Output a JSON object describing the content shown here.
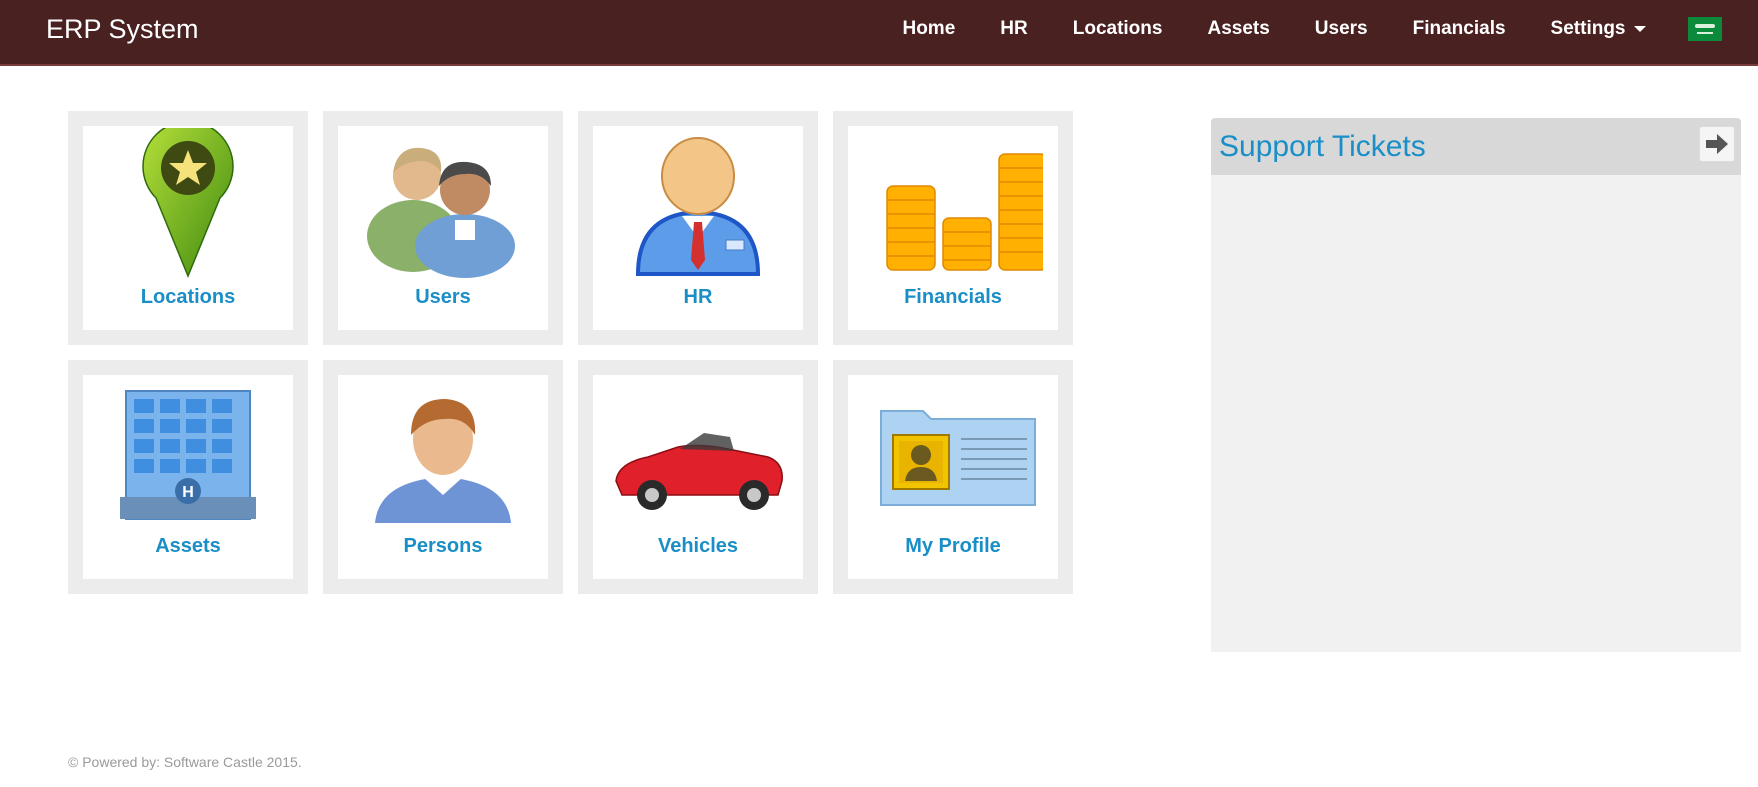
{
  "navbar": {
    "brand": "ERP System",
    "items": [
      {
        "label": "Home"
      },
      {
        "label": "HR"
      },
      {
        "label": "Locations"
      },
      {
        "label": "Assets"
      },
      {
        "label": "Users"
      },
      {
        "label": "Financials"
      },
      {
        "label": "Settings"
      }
    ],
    "language_flag_icon": "saudi-flag-icon"
  },
  "tiles": [
    {
      "label": "Locations",
      "icon": "map-pin-star-icon"
    },
    {
      "label": "Users",
      "icon": "users-group-icon"
    },
    {
      "label": "HR",
      "icon": "businessman-icon"
    },
    {
      "label": "Financials",
      "icon": "coin-stacks-icon"
    },
    {
      "label": "Assets",
      "icon": "building-icon"
    },
    {
      "label": "Persons",
      "icon": "person-icon"
    },
    {
      "label": "Vehicles",
      "icon": "car-icon"
    },
    {
      "label": "My Profile",
      "icon": "id-card-icon"
    }
  ],
  "support": {
    "title": "Support Tickets",
    "arrow_icon": "arrow-right-icon"
  },
  "footer": {
    "text": "© Powered by: Software Castle 2015."
  },
  "colors": {
    "navbar_bg": "#4a2121",
    "link_blue": "#1a8fc7",
    "tile_border": "#ececec",
    "panel_bg": "#f1f1f1"
  }
}
